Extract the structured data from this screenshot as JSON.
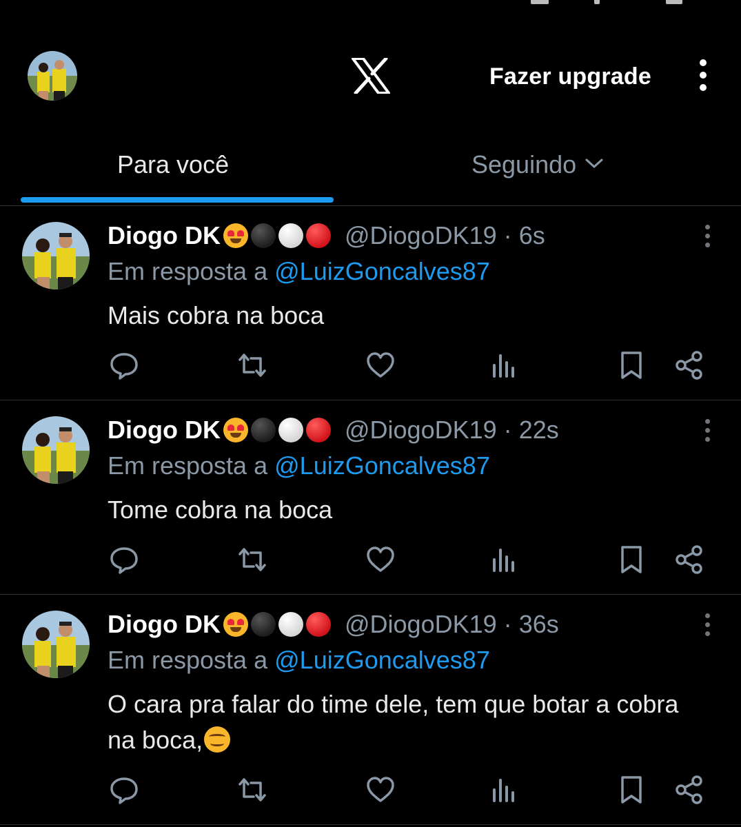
{
  "header": {
    "upgrade_label": "Fazer upgrade"
  },
  "tabs": [
    {
      "label": "Para você",
      "active": true
    },
    {
      "label": "Seguindo",
      "active": false
    }
  ],
  "colors": {
    "background": "#000000",
    "accent": "#1d9bf0",
    "secondary_text": "#8b98a5",
    "divider": "#2f3336"
  },
  "tweets": [
    {
      "name": "Diogo DK",
      "name_emojis": [
        "smiling-face-with-heart-eyes",
        "black-circle",
        "white-circle",
        "red-circle"
      ],
      "handle": "@DiogoDK19",
      "separator": "·",
      "time": "6s",
      "reply_prefix": "Em resposta a",
      "reply_to": "@LuizGoncalves87",
      "text": "Mais cobra na boca",
      "text_emoji": ""
    },
    {
      "name": "Diogo DK",
      "name_emojis": [
        "smiling-face-with-heart-eyes",
        "black-circle",
        "white-circle",
        "red-circle"
      ],
      "handle": "@DiogoDK19",
      "separator": "·",
      "time": "22s",
      "reply_prefix": "Em resposta a",
      "reply_to": "@LuizGoncalves87",
      "text": "Tome cobra na boca",
      "text_emoji": ""
    },
    {
      "name": "Diogo DK",
      "name_emojis": [
        "smiling-face-with-heart-eyes",
        "black-circle",
        "white-circle",
        "red-circle"
      ],
      "handle": "@DiogoDK19",
      "separator": "·",
      "time": "36s",
      "reply_prefix": "Em resposta a",
      "reply_to": "@LuizGoncalves87",
      "text": "O cara pra falar do time dele, tem que botar a cobra na boca,",
      "text_emoji": "smiling-face"
    }
  ],
  "tweet_actions": [
    "reply-icon",
    "retweet-icon",
    "like-icon",
    "views-icon",
    "bookmark-icon",
    "share-icon"
  ]
}
